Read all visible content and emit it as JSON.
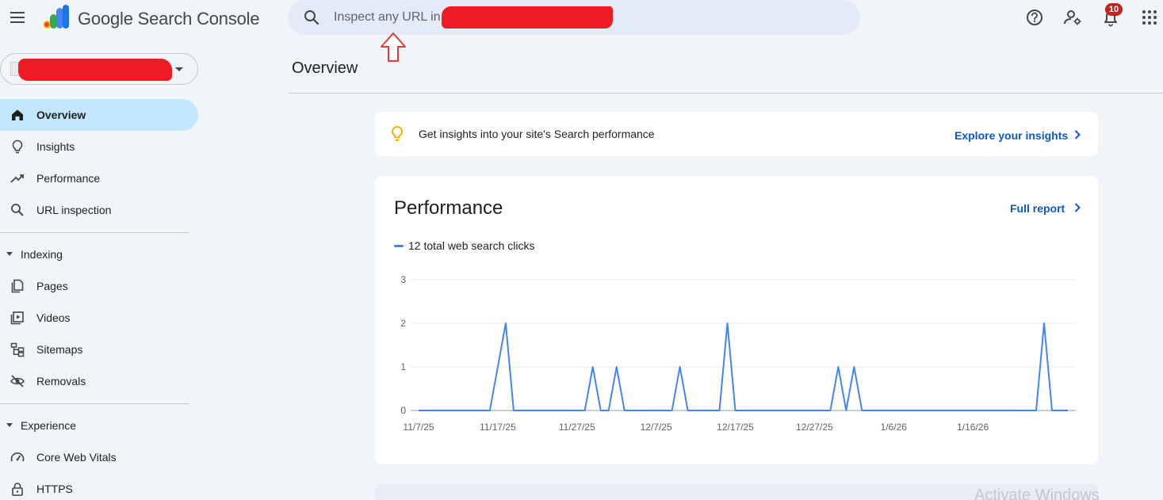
{
  "app": {
    "product_name": "Google Search Console"
  },
  "search": {
    "placeholder": "Inspect any URL in \""
  },
  "header": {
    "notification_count": "10"
  },
  "sidebar": {
    "items_top": [
      {
        "label": "Overview",
        "icon": "home-icon",
        "active": true
      },
      {
        "label": "Insights",
        "icon": "lightbulb-icon"
      },
      {
        "label": "Performance",
        "icon": "trending-up-icon"
      },
      {
        "label": "URL inspection",
        "icon": "search-icon"
      }
    ],
    "indexing": {
      "label": "Indexing",
      "items": [
        {
          "label": "Pages",
          "icon": "pages-icon"
        },
        {
          "label": "Videos",
          "icon": "video-icon"
        },
        {
          "label": "Sitemaps",
          "icon": "sitemap-icon"
        },
        {
          "label": "Removals",
          "icon": "eye-off-icon"
        }
      ]
    },
    "experience": {
      "label": "Experience",
      "items": [
        {
          "label": "Core Web Vitals",
          "icon": "speed-icon"
        },
        {
          "label": "HTTPS",
          "icon": "lock-icon"
        }
      ]
    }
  },
  "main": {
    "page_title": "Overview",
    "insights_card": {
      "text": "Get insights into your site's Search performance",
      "link": "Explore your insights"
    },
    "performance_card": {
      "title": "Performance",
      "link": "Full report",
      "legend": "12 total web search clicks"
    }
  },
  "watermark": "Activate Windows",
  "colors": {
    "accent": "#0b57d0",
    "active_nav": "#c2e7ff",
    "series": "#4285f4",
    "background": "#f1f4f9"
  },
  "chart_data": {
    "type": "line",
    "series": [
      {
        "name": "12 total web search clicks",
        "x": [
          "2025-11-07",
          "2025-11-08",
          "2025-11-09",
          "2025-11-10",
          "2025-11-11",
          "2025-11-12",
          "2025-11-13",
          "2025-11-14",
          "2025-11-15",
          "2025-11-16",
          "2025-11-17",
          "2025-11-18",
          "2025-11-19",
          "2025-11-20",
          "2025-11-21",
          "2025-11-22",
          "2025-11-23",
          "2025-11-24",
          "2025-11-25",
          "2025-11-26",
          "2025-11-27",
          "2025-11-28",
          "2025-11-29",
          "2025-11-30",
          "2025-12-01",
          "2025-12-02",
          "2025-12-03",
          "2025-12-04",
          "2025-12-05",
          "2025-12-06",
          "2025-12-07",
          "2025-12-08",
          "2025-12-09",
          "2025-12-10",
          "2025-12-11",
          "2025-12-12",
          "2025-12-13",
          "2025-12-14",
          "2025-12-15",
          "2025-12-16",
          "2025-12-17",
          "2025-12-18",
          "2025-12-19",
          "2025-12-20",
          "2025-12-21",
          "2025-12-22",
          "2025-12-23",
          "2025-12-24",
          "2025-12-25",
          "2025-12-26",
          "2025-12-27",
          "2025-12-28",
          "2025-12-29",
          "2025-12-30",
          "2025-12-31",
          "2026-01-01",
          "2026-01-02",
          "2026-01-03",
          "2026-01-04",
          "2026-01-05",
          "2026-01-06",
          "2026-01-07",
          "2026-01-08",
          "2026-01-09",
          "2026-01-10",
          "2026-01-11",
          "2026-01-12",
          "2026-01-13",
          "2026-01-14",
          "2026-01-15",
          "2026-01-16",
          "2026-01-17",
          "2026-01-18",
          "2026-01-19",
          "2026-01-20",
          "2026-01-21",
          "2026-01-22",
          "2026-01-23",
          "2026-01-24",
          "2026-01-25",
          "2026-01-26",
          "2026-01-27",
          "2026-01-28"
        ],
        "values": [
          0,
          0,
          0,
          0,
          0,
          0,
          0,
          0,
          0,
          0,
          1,
          2,
          0,
          0,
          0,
          0,
          0,
          0,
          0,
          0,
          0,
          0,
          1,
          0,
          0,
          1,
          0,
          0,
          0,
          0,
          0,
          0,
          0,
          1,
          0,
          0,
          0,
          0,
          0,
          2,
          0,
          0,
          0,
          0,
          0,
          0,
          0,
          0,
          0,
          0,
          0,
          0,
          0,
          1,
          0,
          1,
          0,
          0,
          0,
          0,
          0,
          0,
          0,
          0,
          0,
          0,
          0,
          0,
          0,
          0,
          0,
          0,
          0,
          0,
          0,
          0,
          0,
          0,
          0,
          2,
          0,
          0,
          0
        ]
      }
    ],
    "x_tick_labels": [
      "11/7/25",
      "11/17/25",
      "11/27/25",
      "12/7/25",
      "12/17/25",
      "12/27/25",
      "1/6/26",
      "1/16/26"
    ],
    "y_tick_labels": [
      "0",
      "1",
      "2",
      "3"
    ],
    "ylim": [
      0,
      3
    ],
    "grid": true,
    "legend": "top-left"
  }
}
